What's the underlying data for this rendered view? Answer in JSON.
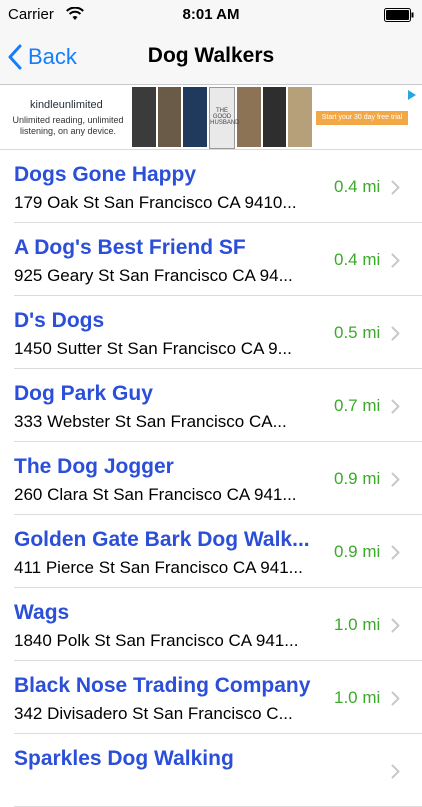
{
  "status_bar": {
    "carrier": "Carrier",
    "time": "8:01 AM"
  },
  "nav": {
    "back_label": "Back",
    "title": "Dog Walkers"
  },
  "ad": {
    "brand": "kindleunlimited",
    "tagline": "Unlimited reading, unlimited listening, on any device.",
    "cta": "Start your 30 day free trial",
    "book_title": "THE GOOD HUSBAND"
  },
  "listings": [
    {
      "name": "Dogs Gone Happy",
      "address": "179 Oak St San Francisco CA 9410...",
      "distance": "0.4 mi"
    },
    {
      "name": "A Dog's Best Friend SF",
      "address": "925 Geary St San Francisco CA 94...",
      "distance": "0.4 mi"
    },
    {
      "name": "D's Dogs",
      "address": "1450 Sutter St San Francisco CA 9...",
      "distance": "0.5 mi"
    },
    {
      "name": "Dog Park Guy",
      "address": "333 Webster St San Francisco CA...",
      "distance": "0.7 mi"
    },
    {
      "name": "The Dog Jogger",
      "address": "260 Clara St San Francisco CA 941...",
      "distance": "0.9 mi"
    },
    {
      "name": "Golden Gate Bark Dog Walk...",
      "address": "411 Pierce St San Francisco CA 941...",
      "distance": "0.9 mi"
    },
    {
      "name": "Wags",
      "address": "1840 Polk St San Francisco CA 941...",
      "distance": "1.0 mi"
    },
    {
      "name": "Black Nose Trading Company",
      "address": "342 Divisadero St San Francisco C...",
      "distance": "1.0 mi"
    },
    {
      "name": "Sparkles Dog Walking",
      "address": "",
      "distance": ""
    }
  ],
  "colors": {
    "accent": "#147efb",
    "name": "#2b4fd8",
    "distance": "#3caa2b"
  }
}
